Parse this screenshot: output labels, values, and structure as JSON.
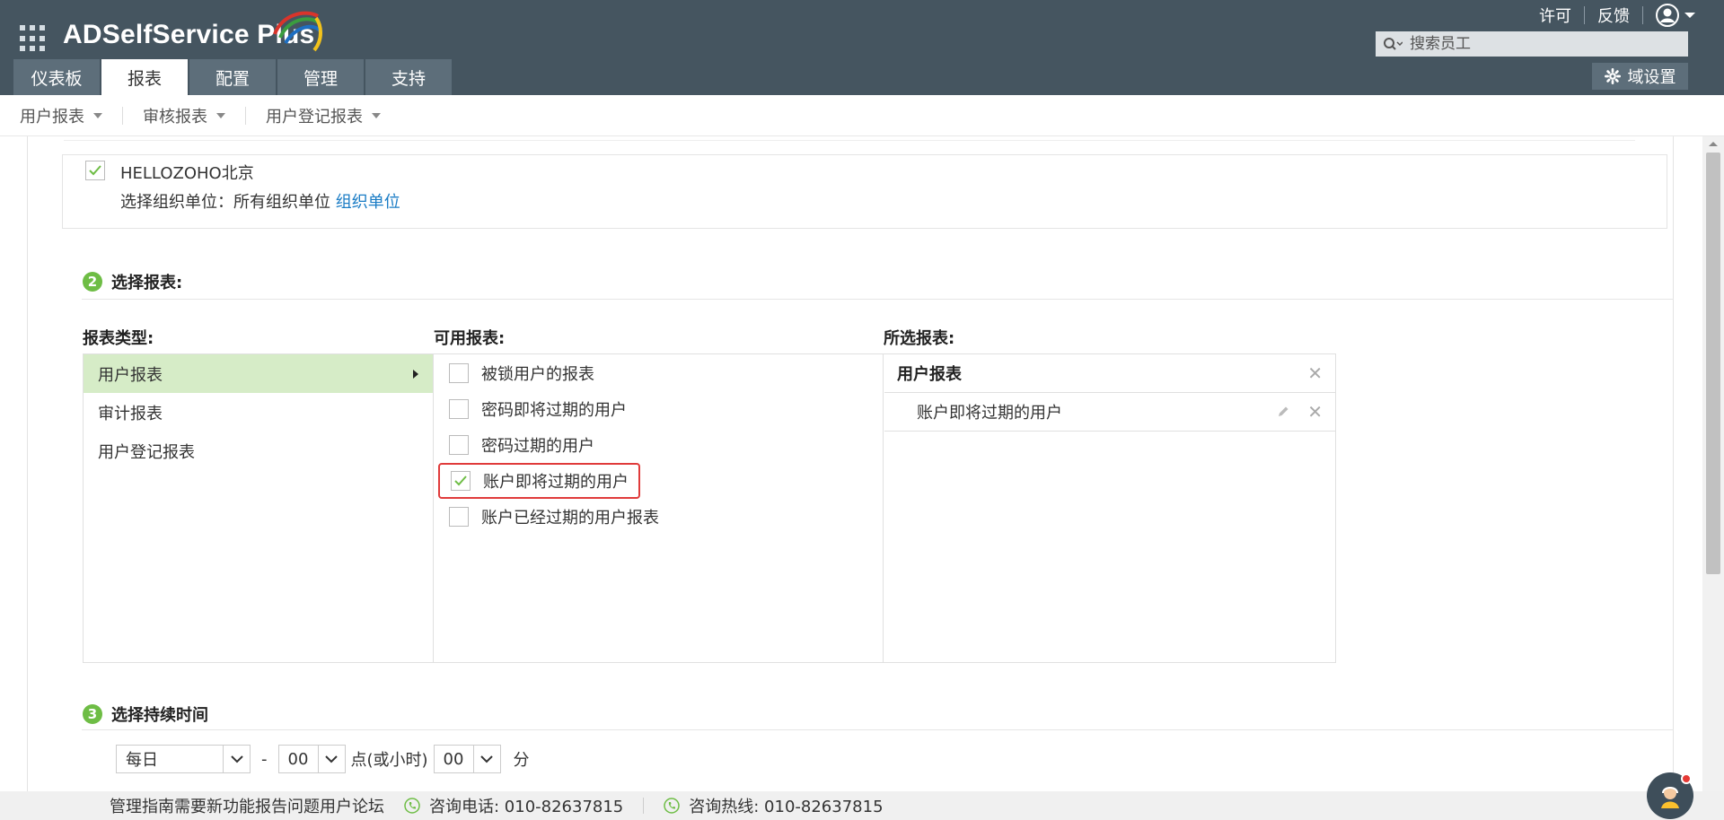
{
  "header": {
    "logo_text": "ADSelfService Plus",
    "top_links": [
      "许可",
      "反馈"
    ],
    "search_placeholder": "搜索员工",
    "tabs": [
      {
        "label": "仪表板",
        "active": false
      },
      {
        "label": "报表",
        "active": true
      },
      {
        "label": "配置",
        "active": false
      },
      {
        "label": "管理",
        "active": false
      },
      {
        "label": "支持",
        "active": false
      }
    ],
    "domain_settings": "域设置"
  },
  "subnav": {
    "items": [
      "用户报表",
      "审核报表",
      "用户登记报表"
    ]
  },
  "ou": {
    "domain_name": "HELLOZOHO北京",
    "select_label": "选择组织单位：所有组织单位 ",
    "link": "组织单位"
  },
  "section2": {
    "number": "2",
    "title": "选择报表:",
    "col_types": "报表类型:",
    "col_available": "可用报表:",
    "col_selected": "所选报表:",
    "types": [
      {
        "label": "用户报表",
        "active": true
      },
      {
        "label": "审计报表",
        "active": false
      },
      {
        "label": "用户登记报表",
        "active": false
      }
    ],
    "available": [
      {
        "label": "被锁用户的报表",
        "checked": false
      },
      {
        "label": "密码即将过期的用户",
        "checked": false
      },
      {
        "label": "密码过期的用户",
        "checked": false
      },
      {
        "label": "账户即将过期的用户",
        "checked": true
      },
      {
        "label": "账户已经过期的用户报表",
        "checked": false
      }
    ],
    "selected_group": "用户报表",
    "selected_items": [
      "账户即将过期的用户"
    ]
  },
  "section3": {
    "number": "3",
    "title": "选择持续时间",
    "freq": "每日",
    "dash": "-",
    "hour": "00",
    "hour_label": "点(或小时)",
    "minute": "00",
    "minute_label": "分"
  },
  "footer": {
    "links": "管理指南需要新功能报告问题用户论坛",
    "phone1": "咨询电话: 010-82637815",
    "phone2": "咨询热线: 010-82637815"
  },
  "colors": {
    "header_bg": "#455560",
    "tab_bg": "#5d6e7a",
    "accent_green": "#6ebd45",
    "active_row": "#d6ecc7",
    "link_blue": "#1a7cc5",
    "highlight_red": "#e03b3b"
  }
}
